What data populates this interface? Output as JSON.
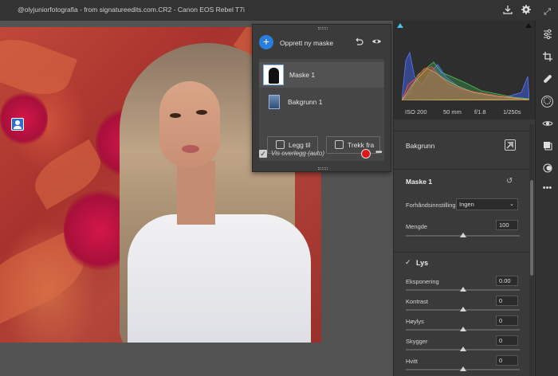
{
  "topbar": {
    "file_info": "@olyjuniorfotografia  - from signatureedits.com.CR2  -  Canon EOS Rebel T7i",
    "icons": [
      "export-icon",
      "settings-icon"
    ]
  },
  "mask_panel": {
    "create_label": "Opprett ny maske",
    "masks": [
      {
        "label": "Maske 1",
        "thumb": "person-silhouette"
      },
      {
        "label": "Bakgrunn 1",
        "thumb": "background"
      }
    ],
    "add_button": "Legg til",
    "subtract_button": "Trekk fra",
    "overlay_label": "Vis overlegg (auto)",
    "overlay_checked": true,
    "overlay_color": "#e01515"
  },
  "histogram": {
    "exif": {
      "iso": "ISO 200",
      "focal": "50 mm",
      "aperture": "f/1.8",
      "shutter": "1/250s"
    }
  },
  "right_panel": {
    "background_label": "Bakgrunn",
    "mask_section": {
      "title": "Maske 1",
      "preset_label": "Forhåndsinnstilling",
      "preset_value": "Ingen",
      "amount_label": "Mengde",
      "amount_value": "100"
    },
    "light_section": {
      "title": "Lys",
      "sliders": [
        {
          "label": "Eksponering",
          "value": "0.00"
        },
        {
          "label": "Kontrast",
          "value": "0"
        },
        {
          "label": "Høylys",
          "value": "0"
        },
        {
          "label": "Skygger",
          "value": "0"
        },
        {
          "label": "Hvitt",
          "value": "0"
        }
      ]
    }
  },
  "tools": [
    "expand-icon",
    "sliders-icon",
    "crop-icon",
    "healing-icon",
    "mask-icon",
    "redeye-icon",
    "presets-icon",
    "layers-icon",
    "more-icon"
  ],
  "colors": {
    "accent": "#2a7de1",
    "panel": "#3a3a3a",
    "overlay_red": "#e01515"
  }
}
